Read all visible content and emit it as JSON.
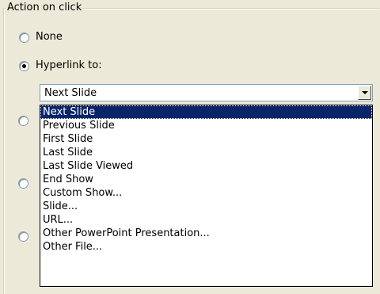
{
  "group": {
    "legend": "Action on click"
  },
  "radios": [
    {
      "label": "None",
      "checked": false
    },
    {
      "label": "Hyperlink to:",
      "checked": true
    }
  ],
  "combo": {
    "value": "Next Slide",
    "icon": "chevron-down-icon"
  },
  "dropdown": {
    "items": [
      "Next Slide",
      "Previous Slide",
      "First Slide",
      "Last Slide",
      "Last Slide Viewed",
      "End Show",
      "Custom Show...",
      "Slide...",
      "URL...",
      "Other PowerPoint Presentation...",
      "Other File..."
    ],
    "selected": "Next Slide"
  }
}
